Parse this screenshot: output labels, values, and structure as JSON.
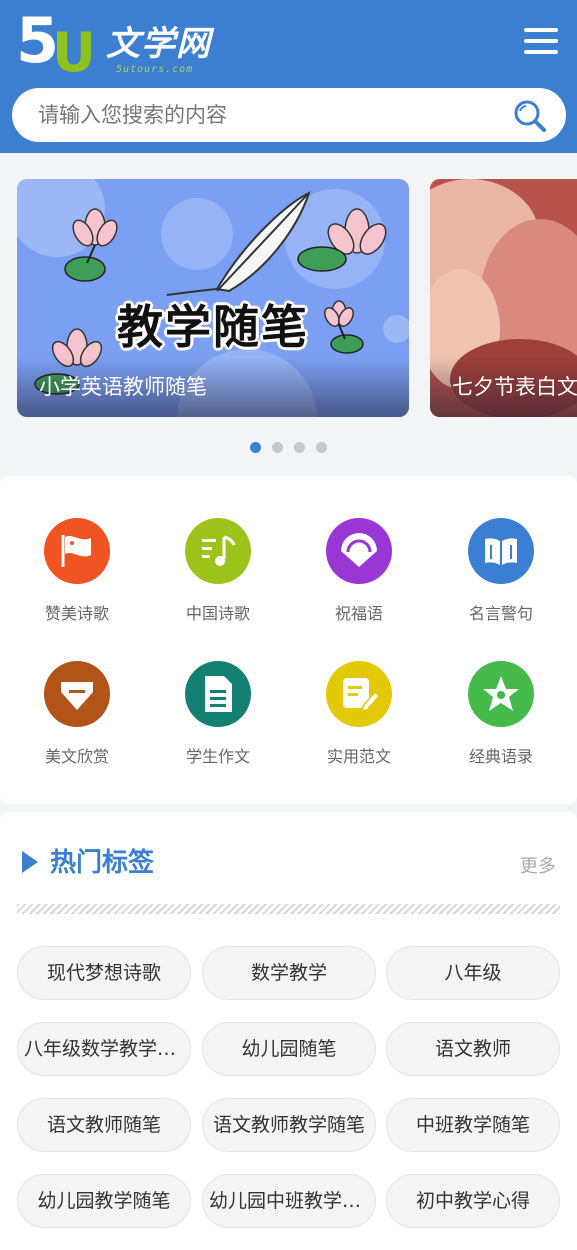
{
  "header": {
    "logo_mark": "5U",
    "logo_text": "文学网",
    "logo_sub": "5utours.com",
    "menu_icon": "hamburger-menu-icon",
    "bg_color": "#3c7fd1"
  },
  "search": {
    "placeholder": "请输入您搜索的内容",
    "value": "",
    "icon": "search-icon"
  },
  "banner": {
    "slides": [
      {
        "title": "教学随笔",
        "caption": "小学英语教师随笔"
      },
      {
        "title": "",
        "caption": "七夕节表白文"
      }
    ],
    "dots": 4,
    "active_dot": 0
  },
  "categories": [
    {
      "label": "赞美诗歌",
      "icon": "flag-icon",
      "color": "#f05423"
    },
    {
      "label": "中国诗歌",
      "icon": "music-note-icon",
      "color": "#9cc31a"
    },
    {
      "label": "祝福语",
      "icon": "fan-icon",
      "color": "#9a35d6"
    },
    {
      "label": "名言警句",
      "icon": "book-icon",
      "color": "#3a7fd3"
    },
    {
      "label": "美文欣赏",
      "icon": "gem-icon",
      "color": "#b2541a"
    },
    {
      "label": "学生作文",
      "icon": "document-icon",
      "color": "#138071"
    },
    {
      "label": "实用范文",
      "icon": "edit-note-icon",
      "color": "#e3ca08"
    },
    {
      "label": "经典语录",
      "icon": "star-flower-icon",
      "color": "#45b94a"
    }
  ],
  "tags": {
    "title": "热门标签",
    "more": "更多",
    "items": [
      "现代梦想诗歌",
      "数学教学",
      "八年级",
      "八年级数学教学随笔",
      "幼儿园随笔",
      "语文教师",
      "语文教师随笔",
      "语文教师教学随笔",
      "中班教学随笔",
      "幼儿园教学随笔",
      "幼儿园中班教学随笔",
      "初中教学心得"
    ]
  }
}
